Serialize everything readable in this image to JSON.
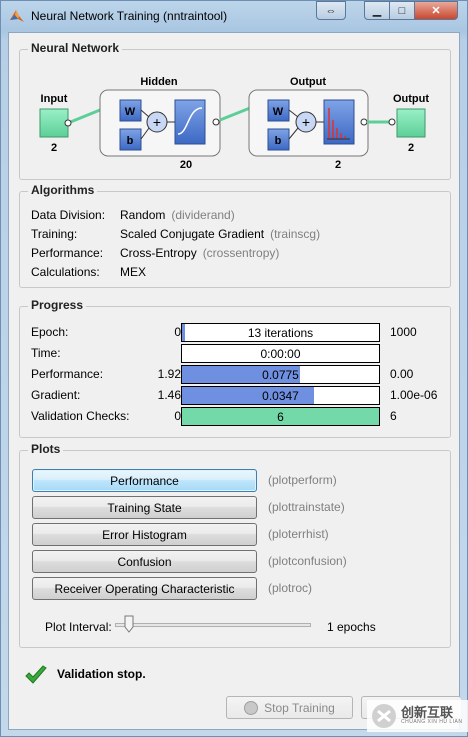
{
  "window": {
    "title": "Neural Network Training (nntraintool)",
    "controls": {
      "restore": "⇔",
      "minimize": "▁",
      "maximize": "□",
      "close": "✕"
    }
  },
  "network": {
    "section_title": "Neural Network",
    "input_label": "Input",
    "input_size": "2",
    "hidden_label": "Hidden",
    "hidden_size": "20",
    "output_layer_label": "Output",
    "output_layer_size": "2",
    "output_label": "Output",
    "output_size": "2",
    "weight_symbol": "W",
    "bias_symbol": "b",
    "sum_symbol": "+"
  },
  "algorithms": {
    "section_title": "Algorithms",
    "rows": [
      {
        "label": "Data Division:",
        "value": "Random",
        "fn": "(dividerand)"
      },
      {
        "label": "Training:",
        "value": "Scaled Conjugate Gradient",
        "fn": "(trainscg)"
      },
      {
        "label": "Performance:",
        "value": "Cross-Entropy",
        "fn": "(crossentropy)"
      },
      {
        "label": "Calculations:",
        "value": "MEX",
        "fn": ""
      }
    ]
  },
  "progress": {
    "section_title": "Progress",
    "rows": [
      {
        "label": "Epoch:",
        "start": "0",
        "bar_text": "13 iterations",
        "end": "1000",
        "fill": 0.013,
        "fill_color": "#6f8fe0"
      },
      {
        "label": "Time:",
        "start": "",
        "bar_text": "0:00:00",
        "end": "",
        "fill": 0,
        "fill_color": "#6f8fe0"
      },
      {
        "label": "Performance:",
        "start": "1.92",
        "bar_text": "0.0775",
        "end": "0.00",
        "fill": 0.6,
        "fill_color": "#6f8fe0"
      },
      {
        "label": "Gradient:",
        "start": "1.46",
        "bar_text": "0.0347",
        "end": "1.00e-06",
        "fill": 0.67,
        "fill_color": "#6f8fe0"
      },
      {
        "label": "Validation Checks:",
        "start": "0",
        "bar_text": "6",
        "end": "6",
        "fill": 1.0,
        "fill_color": "#74d9a8"
      }
    ]
  },
  "plots": {
    "section_title": "Plots",
    "buttons": [
      {
        "label": "Performance",
        "fn": "(plotperform)"
      },
      {
        "label": "Training State",
        "fn": "(plottrainstate)"
      },
      {
        "label": "Error Histogram",
        "fn": "(ploterrhist)"
      },
      {
        "label": "Confusion",
        "fn": "(plotconfusion)"
      },
      {
        "label": "Receiver Operating Characteristic",
        "fn": "(plotroc)"
      }
    ],
    "plot_interval_label": "Plot Interval:",
    "plot_interval_value": "1 epochs"
  },
  "status": {
    "message": "Validation stop."
  },
  "footer": {
    "stop_training_label": "Stop Training"
  },
  "watermark": {
    "text": "创新互联",
    "sub": "CHUANG XIN HU LIAN"
  },
  "colors": {
    "node_green": "#7fe3b3",
    "layer_blue": "#5b88d8",
    "progress_blue": "#6f8fe0",
    "progress_green": "#74d9a8",
    "check_green": "#3aa83a"
  }
}
